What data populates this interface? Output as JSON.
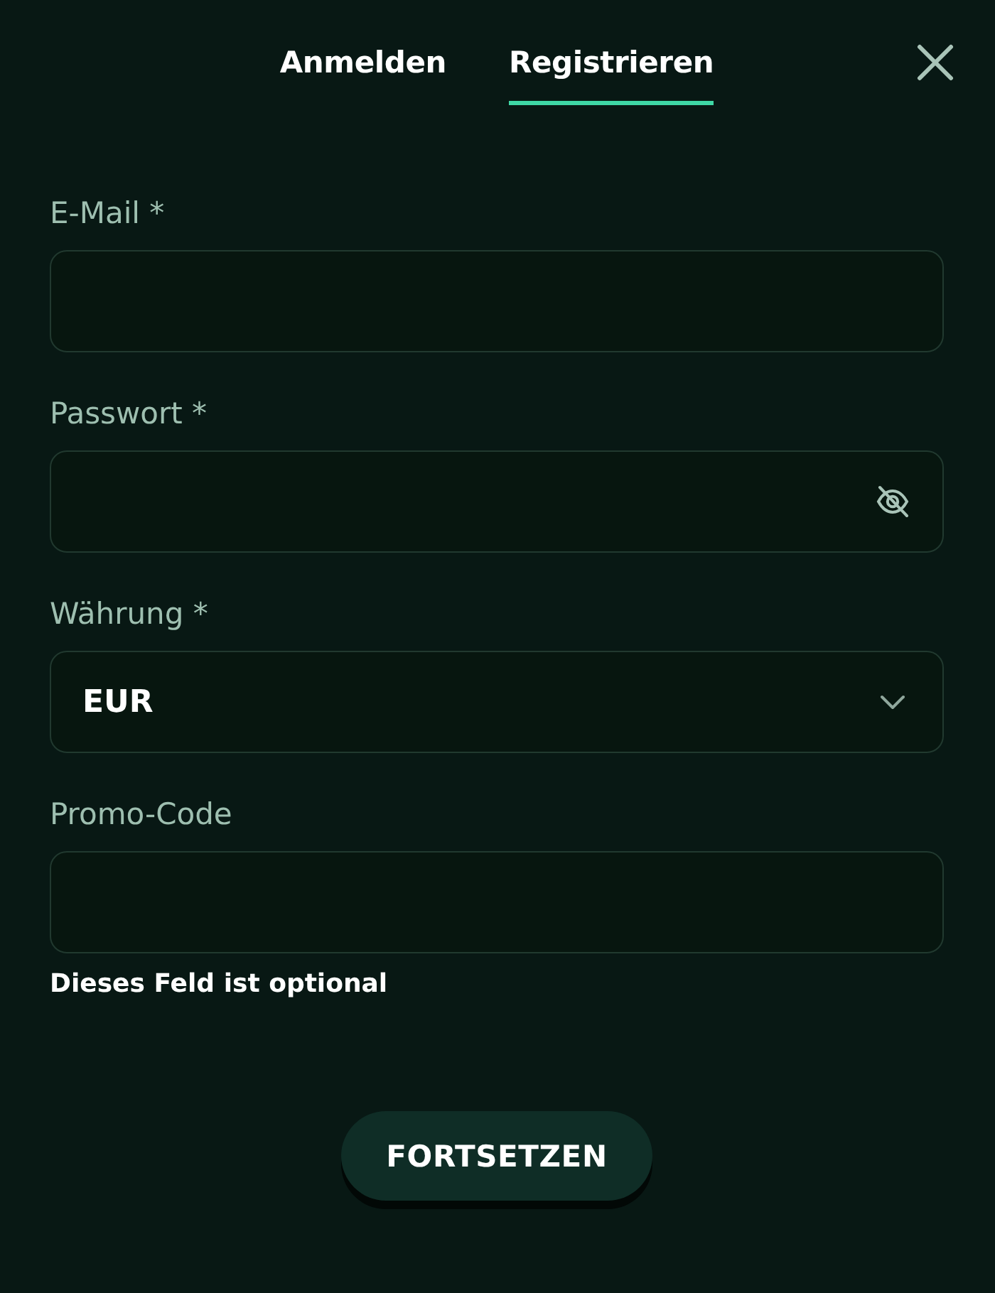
{
  "tabs": [
    {
      "label": "Anmelden",
      "selected": false
    },
    {
      "label": "Registrieren",
      "selected": true
    }
  ],
  "fields": [
    {
      "kind": "text",
      "label": "E-Mail *"
    },
    {
      "kind": "password",
      "label": "Passwort *"
    },
    {
      "kind": "select",
      "label": "Währung *",
      "value": "EUR"
    },
    {
      "kind": "text",
      "label": "Promo-Code",
      "helper_text": "Dieses Feld ist optional"
    }
  ],
  "submit_button": {
    "label": "FORTSETZEN"
  }
}
